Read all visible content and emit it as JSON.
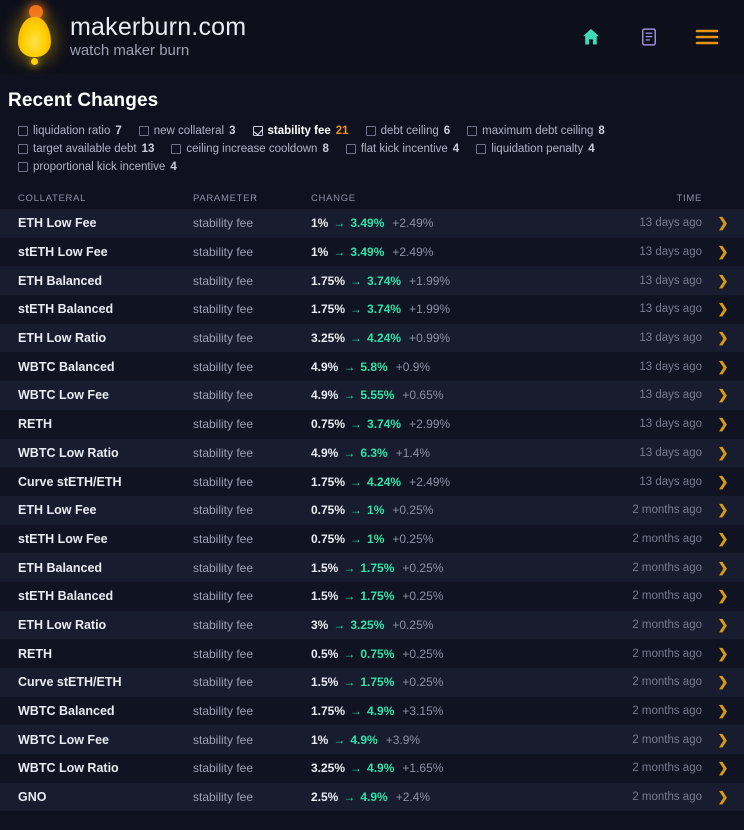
{
  "header": {
    "brand_title": "makerburn.com",
    "brand_subtitle": "watch maker burn",
    "logo_icon": "flame-icon",
    "nav": [
      {
        "name": "home-icon",
        "label": "Home",
        "color": "#3fd9b4"
      },
      {
        "name": "document-icon",
        "label": "Reports",
        "color": "#9b8cd4"
      },
      {
        "name": "hamburger-menu-icon",
        "label": "Menu",
        "color": "#e8930c"
      }
    ]
  },
  "page": {
    "title": "Recent Changes"
  },
  "filters": [
    {
      "label": "liquidation ratio",
      "count": "7",
      "checked": false
    },
    {
      "label": "new collateral",
      "count": "3",
      "checked": false
    },
    {
      "label": "stability fee",
      "count": "21",
      "checked": true
    },
    {
      "label": "debt ceiling",
      "count": "6",
      "checked": false
    },
    {
      "label": "maximum debt ceiling",
      "count": "8",
      "checked": false
    },
    {
      "label": "target available debt",
      "count": "13",
      "checked": false
    },
    {
      "label": "ceiling increase cooldown",
      "count": "8",
      "checked": false
    },
    {
      "label": "flat kick incentive",
      "count": "4",
      "checked": false
    },
    {
      "label": "liquidation penalty",
      "count": "4",
      "checked": false
    },
    {
      "label": "proportional kick incentive",
      "count": "4",
      "checked": false
    }
  ],
  "table": {
    "columns": {
      "collateral": "COLLATERAL",
      "parameter": "PARAMETER",
      "change": "CHANGE",
      "time": "TIME"
    },
    "arrow_glyph": "→",
    "chevron_glyph": "❯",
    "rows": [
      {
        "collateral": "ETH Low Fee",
        "parameter": "stability fee",
        "from": "1%",
        "to": "3.49%",
        "delta": "+2.49%",
        "time": "13 days ago"
      },
      {
        "collateral": "stETH Low Fee",
        "parameter": "stability fee",
        "from": "1%",
        "to": "3.49%",
        "delta": "+2.49%",
        "time": "13 days ago"
      },
      {
        "collateral": "ETH Balanced",
        "parameter": "stability fee",
        "from": "1.75%",
        "to": "3.74%",
        "delta": "+1.99%",
        "time": "13 days ago"
      },
      {
        "collateral": "stETH Balanced",
        "parameter": "stability fee",
        "from": "1.75%",
        "to": "3.74%",
        "delta": "+1.99%",
        "time": "13 days ago"
      },
      {
        "collateral": "ETH Low Ratio",
        "parameter": "stability fee",
        "from": "3.25%",
        "to": "4.24%",
        "delta": "+0.99%",
        "time": "13 days ago"
      },
      {
        "collateral": "WBTC Balanced",
        "parameter": "stability fee",
        "from": "4.9%",
        "to": "5.8%",
        "delta": "+0.9%",
        "time": "13 days ago"
      },
      {
        "collateral": "WBTC Low Fee",
        "parameter": "stability fee",
        "from": "4.9%",
        "to": "5.55%",
        "delta": "+0.65%",
        "time": "13 days ago"
      },
      {
        "collateral": "RETH",
        "parameter": "stability fee",
        "from": "0.75%",
        "to": "3.74%",
        "delta": "+2.99%",
        "time": "13 days ago"
      },
      {
        "collateral": "WBTC Low Ratio",
        "parameter": "stability fee",
        "from": "4.9%",
        "to": "6.3%",
        "delta": "+1.4%",
        "time": "13 days ago"
      },
      {
        "collateral": "Curve stETH/ETH",
        "parameter": "stability fee",
        "from": "1.75%",
        "to": "4.24%",
        "delta": "+2.49%",
        "time": "13 days ago"
      },
      {
        "collateral": "ETH Low Fee",
        "parameter": "stability fee",
        "from": "0.75%",
        "to": "1%",
        "delta": "+0.25%",
        "time": "2 months ago"
      },
      {
        "collateral": "stETH Low Fee",
        "parameter": "stability fee",
        "from": "0.75%",
        "to": "1%",
        "delta": "+0.25%",
        "time": "2 months ago"
      },
      {
        "collateral": "ETH Balanced",
        "parameter": "stability fee",
        "from": "1.5%",
        "to": "1.75%",
        "delta": "+0.25%",
        "time": "2 months ago"
      },
      {
        "collateral": "stETH Balanced",
        "parameter": "stability fee",
        "from": "1.5%",
        "to": "1.75%",
        "delta": "+0.25%",
        "time": "2 months ago"
      },
      {
        "collateral": "ETH Low Ratio",
        "parameter": "stability fee",
        "from": "3%",
        "to": "3.25%",
        "delta": "+0.25%",
        "time": "2 months ago"
      },
      {
        "collateral": "RETH",
        "parameter": "stability fee",
        "from": "0.5%",
        "to": "0.75%",
        "delta": "+0.25%",
        "time": "2 months ago"
      },
      {
        "collateral": "Curve stETH/ETH",
        "parameter": "stability fee",
        "from": "1.5%",
        "to": "1.75%",
        "delta": "+0.25%",
        "time": "2 months ago"
      },
      {
        "collateral": "WBTC Balanced",
        "parameter": "stability fee",
        "from": "1.75%",
        "to": "4.9%",
        "delta": "+3.15%",
        "time": "2 months ago"
      },
      {
        "collateral": "WBTC Low Fee",
        "parameter": "stability fee",
        "from": "1%",
        "to": "4.9%",
        "delta": "+3.9%",
        "time": "2 months ago"
      },
      {
        "collateral": "WBTC Low Ratio",
        "parameter": "stability fee",
        "from": "3.25%",
        "to": "4.9%",
        "delta": "+1.65%",
        "time": "2 months ago"
      },
      {
        "collateral": "GNO",
        "parameter": "stability fee",
        "from": "2.5%",
        "to": "4.9%",
        "delta": "+2.4%",
        "time": "2 months ago"
      }
    ]
  },
  "colors": {
    "page_bg": "#0f1120",
    "header_bg": "#0d0f1a",
    "row_odd": "#171c2e",
    "accent_green": "#2fe3a8",
    "accent_orange": "#e8930c",
    "accent_gold": "#d99a16",
    "accent_teal": "#3fd9b4",
    "accent_purple": "#9b8cd4"
  }
}
